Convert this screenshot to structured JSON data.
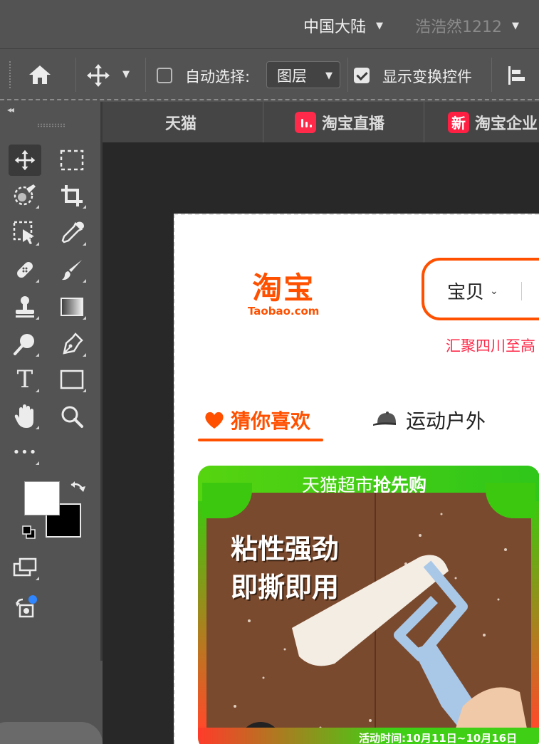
{
  "menubar": {
    "region": "中国大陆",
    "user": "浩浩然1212"
  },
  "options_bar": {
    "auto_select_label": "自动选择:",
    "auto_select_checked": false,
    "auto_select_target": "图层",
    "show_transform_label": "显示变换控件",
    "show_transform_checked": true
  },
  "tools": [
    {
      "name": "move-tool",
      "icon": "move-icon"
    },
    {
      "name": "marquee-tool",
      "icon": "rect-marquee-icon"
    },
    {
      "name": "quick-select-tool",
      "icon": "quick-select-icon"
    },
    {
      "name": "crop-tool",
      "icon": "crop-icon"
    },
    {
      "name": "frame-tool",
      "icon": "frame-select-icon"
    },
    {
      "name": "eyedropper-tool",
      "icon": "eyedropper-icon"
    },
    {
      "name": "healing-tool",
      "icon": "bandage-icon"
    },
    {
      "name": "brush-tool",
      "icon": "brush-icon"
    },
    {
      "name": "stamp-tool",
      "icon": "stamp-icon"
    },
    {
      "name": "gradient-tool",
      "icon": "gradient-icon"
    },
    {
      "name": "dodge-tool",
      "icon": "dodge-icon"
    },
    {
      "name": "pen-tool",
      "icon": "pen-icon"
    },
    {
      "name": "type-tool",
      "icon": "type-icon",
      "glyph": "T"
    },
    {
      "name": "shape-tool",
      "icon": "rectangle-icon"
    },
    {
      "name": "hand-tool",
      "icon": "hand-icon"
    },
    {
      "name": "zoom-tool",
      "icon": "zoom-icon"
    },
    {
      "name": "more-tools",
      "icon": "ellipsis-icon",
      "glyph": "•••"
    }
  ],
  "colors": {
    "foreground": "#ffffff",
    "background": "#000000",
    "accent": "#ff5000",
    "ui_bg": "#535353",
    "canvas_bg": "#282828"
  },
  "tabs": [
    {
      "label": "天猫"
    },
    {
      "label": "淘宝直播",
      "badge": "live"
    },
    {
      "label": "淘宝企业",
      "badge": "新"
    }
  ],
  "page": {
    "logo_cn": "淘宝",
    "logo_en": "Taobao.com",
    "search_category": "宝贝",
    "promo_text": "汇聚四川至高",
    "feed_tabs": [
      {
        "label": "猜你喜欢",
        "active": true,
        "icon": "heart-icon"
      },
      {
        "label": "运动户外",
        "active": false,
        "icon": "cap-icon"
      }
    ],
    "card": {
      "header_plain": "天猫超市",
      "header_bold": "抢先购",
      "slogan_line1": "粘性强劲",
      "slogan_line2": "即撕即用",
      "footer": "活动时间:10月11日~10月16日"
    }
  }
}
